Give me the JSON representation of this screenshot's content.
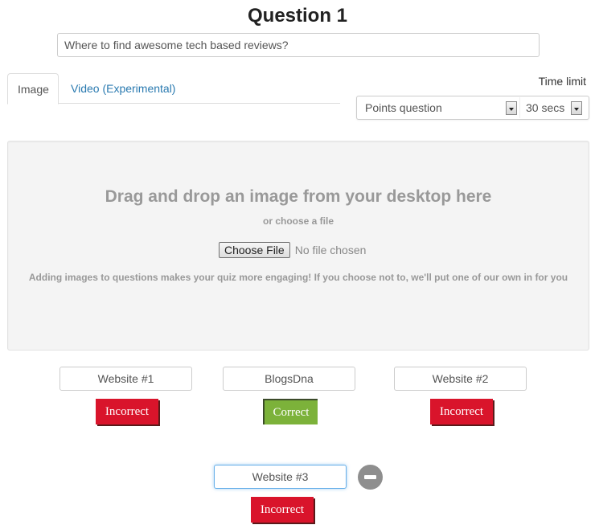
{
  "header": {
    "title": "Question 1",
    "question_value": "Where to find awesome tech based reviews?"
  },
  "tabs": [
    {
      "label": "Image",
      "active": true
    },
    {
      "label": "Video (Experimental)",
      "active": false
    }
  ],
  "settings": {
    "time_limit_label": "Time limit",
    "question_type": "Points question",
    "time_limit": "30 secs"
  },
  "dropzone": {
    "heading": "Drag and drop an image from your desktop here",
    "subheading": "or choose a file",
    "choose_file_label": "Choose File",
    "no_file_text": "No file chosen",
    "hint": "Adding images to questions makes your quiz more engaging! If you choose not to, we'll put one of our own in for you"
  },
  "answers": [
    {
      "value": "Website #1",
      "status": "Incorrect"
    },
    {
      "value": "BlogsDna",
      "status": "Correct"
    },
    {
      "value": "Website #2",
      "status": "Incorrect"
    },
    {
      "value": "Website #3",
      "status": "Incorrect"
    }
  ],
  "colors": {
    "incorrect": "#d9142b",
    "correct": "#7cb23a",
    "link": "#2a7ab0"
  }
}
